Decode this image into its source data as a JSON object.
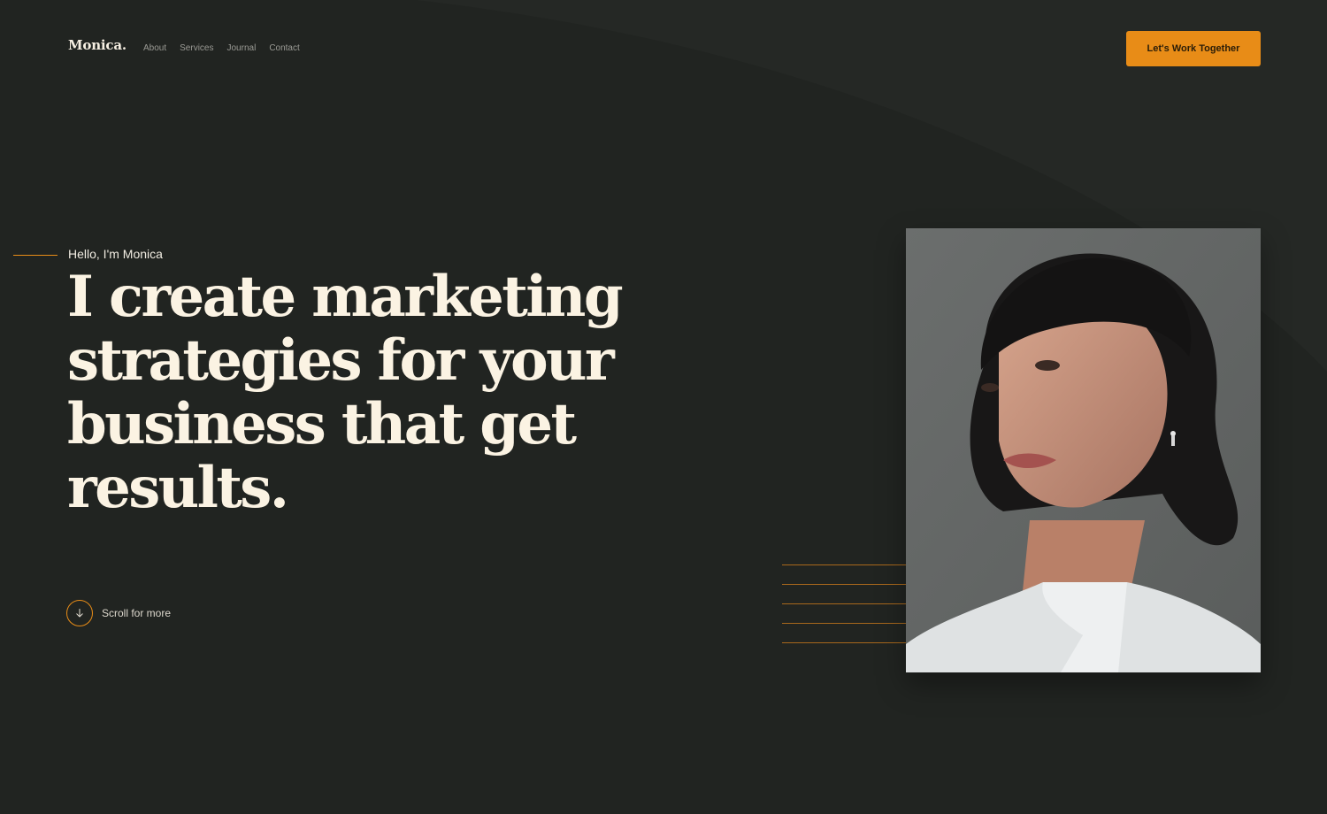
{
  "brand": {
    "logo": "Monica."
  },
  "nav": {
    "items": [
      {
        "label": "About"
      },
      {
        "label": "Services"
      },
      {
        "label": "Journal"
      },
      {
        "label": "Contact"
      }
    ]
  },
  "header": {
    "cta_label": "Let's Work Together"
  },
  "hero": {
    "eyebrow": "Hello, I'm Monica",
    "headline_lines": [
      "I create marketing",
      "strategies for your",
      "business that get",
      "results."
    ],
    "scroll_label": "Scroll for more",
    "scroll_icon": "arrow-down-icon"
  },
  "portrait": {
    "icon": "portrait-photo"
  },
  "colors": {
    "background": "#212421",
    "accent": "#e88c17",
    "headline": "#fbf3e3",
    "nav_text": "#9a9a94"
  }
}
